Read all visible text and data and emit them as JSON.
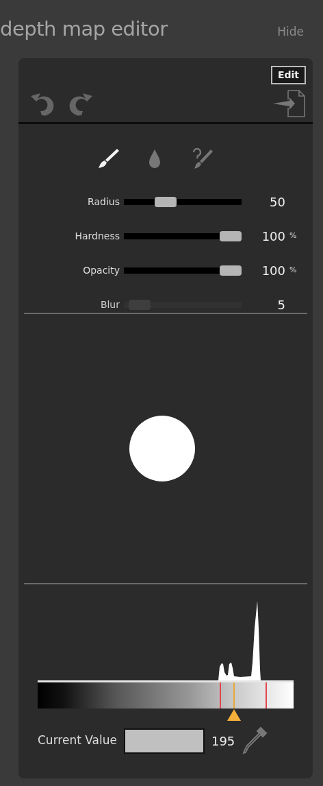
{
  "title": "depth map editor",
  "hide_link": "Hide",
  "edit_button": "Edit",
  "tools": [
    {
      "kind": "brush",
      "selected": true
    },
    {
      "kind": "drop",
      "selected": false
    },
    {
      "kind": "eraser",
      "selected": false
    }
  ],
  "sliders": [
    {
      "label": "Radius",
      "level": 0.32,
      "reading": "50",
      "disabled": false
    },
    {
      "label": "Hardness",
      "level": 1,
      "reading": "100",
      "unit": "%",
      "disabled": false
    },
    {
      "label": "Opacity",
      "level": 1,
      "reading": "100",
      "unit": "%",
      "disabled": false
    },
    {
      "label": "Blur",
      "level": 0.05,
      "reading": "5",
      "disabled": true
    }
  ],
  "gradient_markers": [
    {
      "kind": "range",
      "level": 0.71
    },
    {
      "kind": "current",
      "level": 0.765
    },
    {
      "kind": "range",
      "level": 0.89
    }
  ],
  "current_value": {
    "label": "Current Value",
    "reading": "195"
  }
}
